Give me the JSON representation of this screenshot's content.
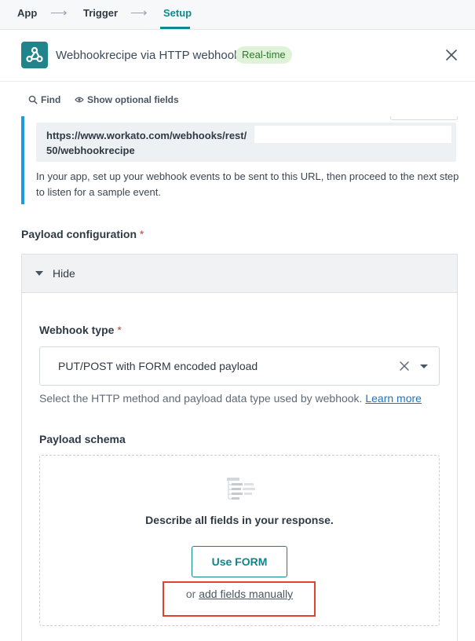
{
  "breadcrumb": {
    "items": [
      "App",
      "Trigger",
      "Setup"
    ],
    "active": "Setup"
  },
  "header": {
    "title": "Webhookrecipe via HTTP webhook",
    "badge": "Real-time",
    "accent": "#20858a"
  },
  "toolbar": {
    "find_label": "Find",
    "optional_label": "Show optional fields"
  },
  "webhook_url": {
    "line1": "https://www.workato.com/webhooks/rest/",
    "line2": "50/webhookrecipe",
    "help": "In your app, set up your webhook events to be sent to this URL, then proceed to the next step to listen for a sample event."
  },
  "payload_config": {
    "label": "Payload configuration",
    "required_mark": "*",
    "toggle_label": "Hide",
    "webhook_type": {
      "label": "Webhook type",
      "required_mark": "*",
      "value": "PUT/POST with FORM encoded payload",
      "hint": "Select the HTTP method and payload data type used by webhook.",
      "hint_link": "Learn more"
    },
    "schema": {
      "label": "Payload schema",
      "describe": "Describe all fields in your response.",
      "use_form_label": "Use FORM",
      "or_text": "or",
      "manual_link": "add fields manually"
    }
  },
  "colors": {
    "link": "#1e73be",
    "highlight": "#e0422a",
    "rail": "#1e9be0"
  }
}
